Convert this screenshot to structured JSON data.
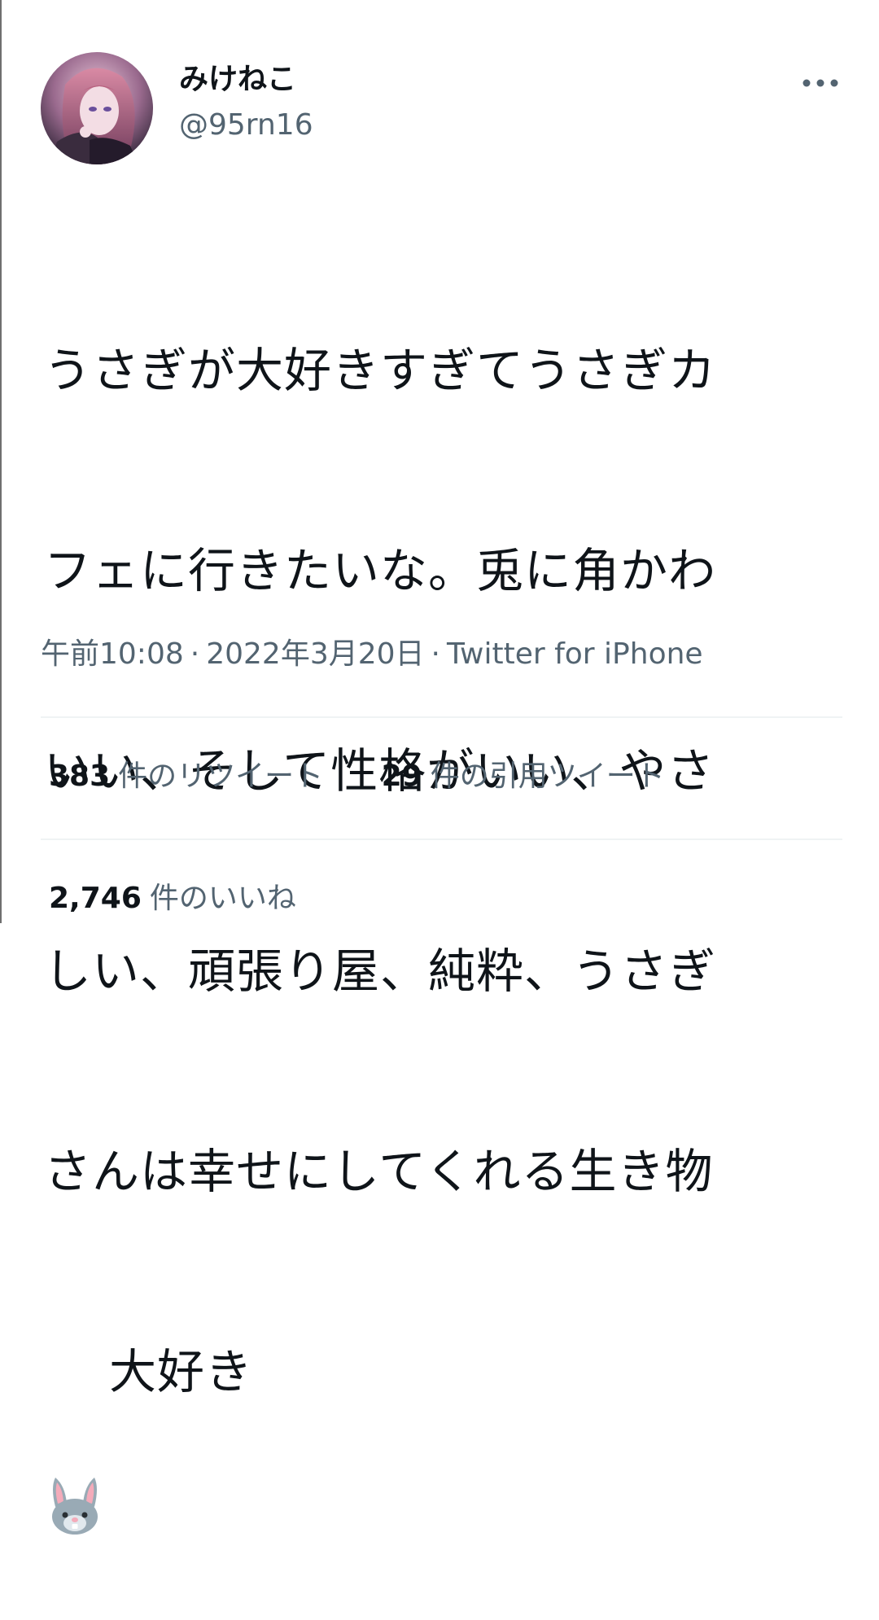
{
  "user": {
    "display_name": "みけねこ",
    "handle": "@95rn16"
  },
  "tweet": {
    "text_lines": [
      "うさぎが大好きすぎてうさぎカ",
      "フェに行きたいな。兎に角かわ",
      "いい、そして性格がいい、やさ",
      "しい、頑張り屋、純粋、うさぎ",
      "さんは幸せにしてくれる生き物"
    ],
    "emoji_icon": "rabbit-face-icon",
    "last_line_text": "大好き"
  },
  "meta": {
    "time": "午前10:08",
    "separator": "·",
    "date": "2022年3月20日",
    "source": "Twitter for iPhone"
  },
  "stats": {
    "retweets": {
      "count": "383",
      "label": "件のリツイート"
    },
    "quotes": {
      "count": "29",
      "label": "件の引用ツイート"
    },
    "likes": {
      "count": "2,746",
      "label": "件のいいね"
    }
  },
  "colors": {
    "text_primary": "#0f1419",
    "text_secondary": "#536471",
    "divider": "#eff3f4"
  }
}
